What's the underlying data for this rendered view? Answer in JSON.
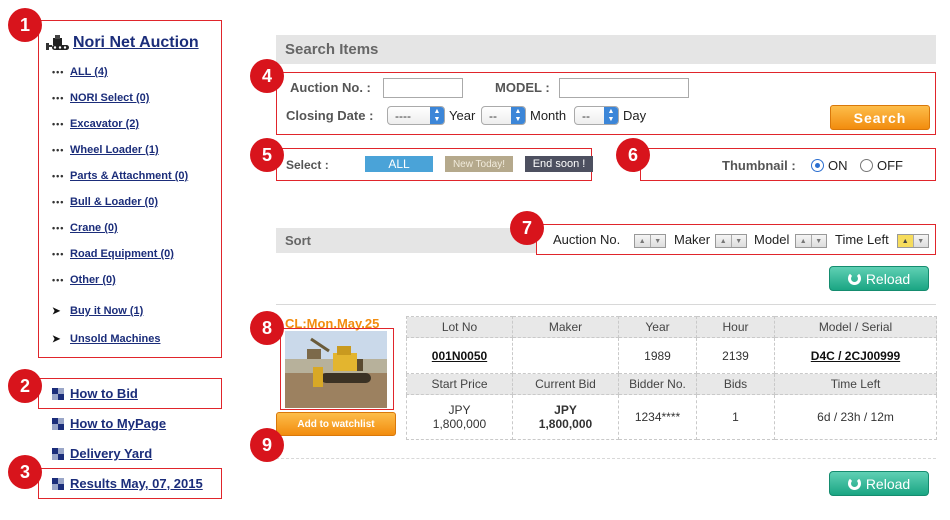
{
  "sidebar": {
    "brand": "Nori Net Auction",
    "categories": [
      "ALL (4)",
      "NORI Select (0)",
      "Excavator (2)",
      "Wheel Loader (1)",
      "Parts & Attachment (0)",
      "Bull & Loader (0)",
      "Crane (0)",
      "Road Equipment (0)",
      "Other (0)"
    ],
    "extras": [
      "Buy it Now (1)",
      "Unsold Machines"
    ],
    "links": [
      "How to Bid",
      "How to MyPage",
      "Delivery Yard",
      "Results May, 07, 2015"
    ]
  },
  "badges": [
    "1",
    "2",
    "3",
    "4",
    "5",
    "6",
    "7",
    "8",
    "9"
  ],
  "search": {
    "title": "Search Items",
    "auction_no_label": "Auction No. :",
    "auction_no_value": "",
    "model_label": "MODEL :",
    "model_value": "",
    "closing_label": "Closing Date :",
    "year_value": "----",
    "year_label": "Year",
    "month_value": "--",
    "month_label": "Month",
    "day_value": "--",
    "day_label": "Day",
    "button": "Search"
  },
  "select": {
    "label": "Select :",
    "all": "ALL",
    "new_today": "New Today!",
    "end_soon": "End soon !"
  },
  "thumbnail": {
    "label": "Thumbnail :",
    "on": "ON",
    "off": "OFF",
    "selected": "ON"
  },
  "sort": {
    "title": "Sort",
    "fields": [
      "Auction No.",
      "Maker",
      "Model",
      "Time Left"
    ]
  },
  "reload_label": "Reload",
  "lot": {
    "closing": "CL:Mon.May.25",
    "watch_button": "Add to watchlist",
    "headers1": [
      "Lot No",
      "Maker",
      "Year",
      "Hour",
      "Model / Serial"
    ],
    "values1": [
      "001N0050",
      "",
      "1989",
      "2139",
      "D4C / 2CJ00999"
    ],
    "headers2": [
      "Start Price",
      "Current Bid",
      "Bidder No.",
      "Bids",
      "Time Left"
    ],
    "start_currency": "JPY",
    "start_amount": "1,800,000",
    "bid_currency": "JPY",
    "bid_amount": "1,800,000",
    "bidder_no": "1234****",
    "bids": "1",
    "time_left": "6d / 23h / 12m"
  },
  "colors": {
    "badge": "#d8141c",
    "link": "#1b2d7a",
    "search_button": "#f28c0e",
    "reload_button": "#1aa583",
    "chip_all": "#4aa3d8",
    "chip_new": "#b5a98c",
    "chip_end": "#4d5060",
    "closing_text": "#f28c0e"
  }
}
